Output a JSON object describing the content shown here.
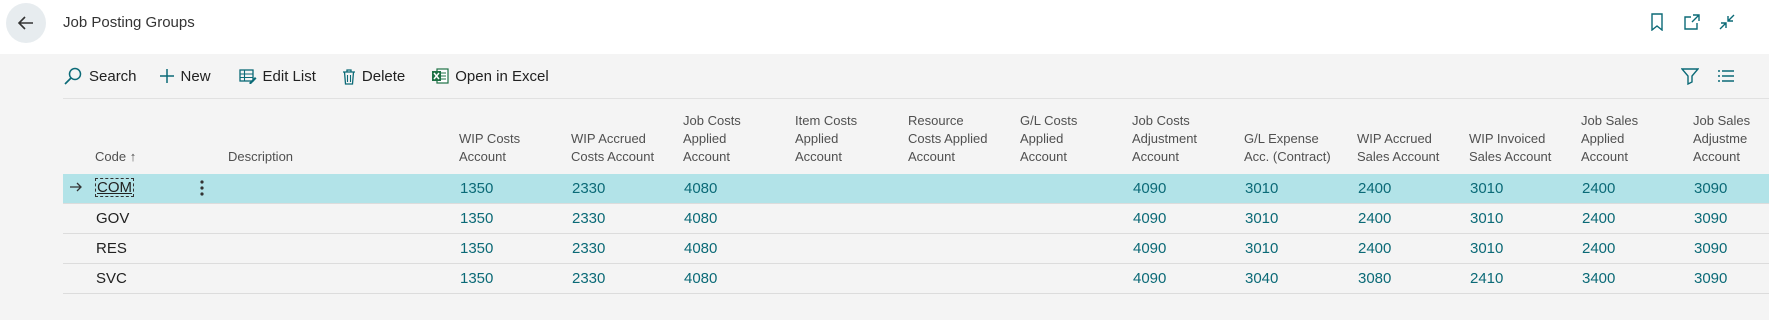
{
  "header": {
    "title": "Job Posting Groups"
  },
  "toolbar": {
    "search": "Search",
    "new": "New",
    "edit_list": "Edit List",
    "delete": "Delete",
    "open_in_excel": "Open in Excel"
  },
  "columns": {
    "code": "Code",
    "description": "Description",
    "wip_costs": [
      "WIP Costs",
      "Account"
    ],
    "wip_accrued_costs": [
      "WIP Accrued",
      "Costs Account"
    ],
    "job_costs_applied": [
      "Job Costs",
      "Applied",
      "Account"
    ],
    "item_costs_applied": [
      "Item Costs",
      "Applied",
      "Account"
    ],
    "resource_costs_applied": [
      "Resource",
      "Costs Applied",
      "Account"
    ],
    "gl_costs_applied": [
      "G/L Costs",
      "Applied",
      "Account"
    ],
    "job_costs_adjustment": [
      "Job Costs",
      "Adjustment",
      "Account"
    ],
    "gl_expense_contract": [
      "G/L Expense",
      "Acc. (Contract)"
    ],
    "wip_accrued_sales": [
      "WIP Accrued",
      "Sales Account"
    ],
    "wip_invoiced_sales": [
      "WIP Invoiced",
      "Sales Account"
    ],
    "job_sales_applied": [
      "Job Sales",
      "Applied",
      "Account"
    ],
    "job_sales_adjustment": [
      "Job Sales",
      "Adjustme",
      "Account"
    ]
  },
  "sort_indicator": "↑",
  "rows": [
    {
      "code": "COM",
      "wip_costs": "1350",
      "wip_accrued_costs": "2330",
      "job_costs_applied": "4080",
      "job_costs_adjustment": "4090",
      "gl_expense_contract": "3010",
      "wip_accrued_sales": "2400",
      "wip_invoiced_sales": "3010",
      "job_sales_applied": "2400",
      "job_sales_adjustment": "3090"
    },
    {
      "code": "GOV",
      "wip_costs": "1350",
      "wip_accrued_costs": "2330",
      "job_costs_applied": "4080",
      "job_costs_adjustment": "4090",
      "gl_expense_contract": "3010",
      "wip_accrued_sales": "2400",
      "wip_invoiced_sales": "3010",
      "job_sales_applied": "2400",
      "job_sales_adjustment": "3090"
    },
    {
      "code": "RES",
      "wip_costs": "1350",
      "wip_accrued_costs": "2330",
      "job_costs_applied": "4080",
      "job_costs_adjustment": "4090",
      "gl_expense_contract": "3010",
      "wip_accrued_sales": "2400",
      "wip_invoiced_sales": "3010",
      "job_sales_applied": "2400",
      "job_sales_adjustment": "3090"
    },
    {
      "code": "SVC",
      "wip_costs": "1350",
      "wip_accrued_costs": "2330",
      "job_costs_applied": "4080",
      "job_costs_adjustment": "4090",
      "gl_expense_contract": "3040",
      "wip_accrued_sales": "3080",
      "wip_invoiced_sales": "2410",
      "job_sales_applied": "3400",
      "job_sales_adjustment": "3090"
    }
  ],
  "colors": {
    "accent": "#0b6a77",
    "selected_row": "#b2e3e8",
    "excel_green": "#1e7145"
  }
}
